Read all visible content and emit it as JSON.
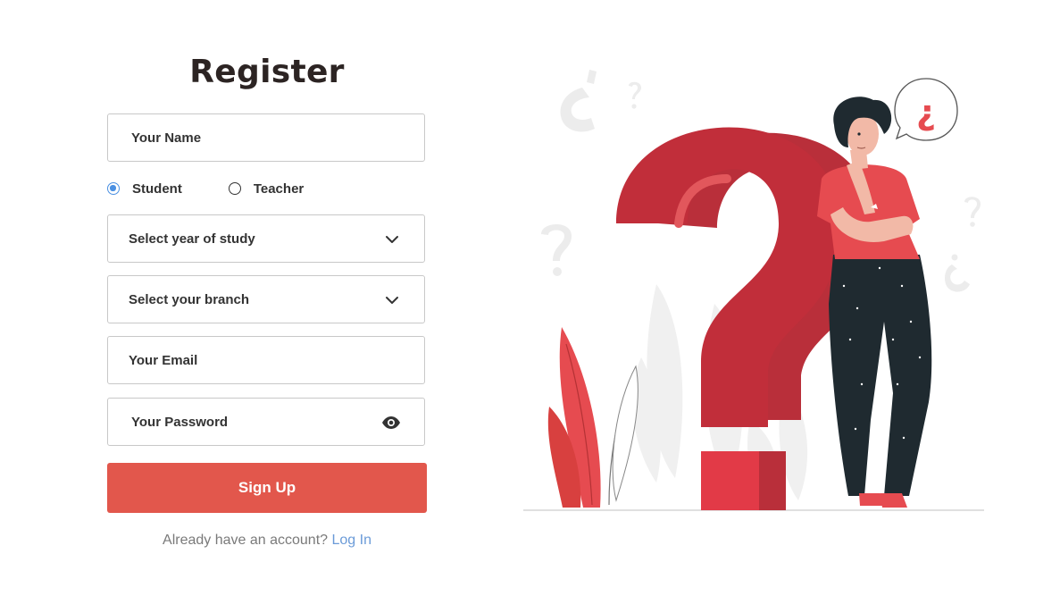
{
  "form": {
    "title": "Register",
    "name_placeholder": "Your Name",
    "role_options": [
      {
        "label": "Student",
        "checked": true
      },
      {
        "label": "Teacher",
        "checked": false
      }
    ],
    "year_select": "Select year of study",
    "branch_select": "Select your branch",
    "email_placeholder": "Your Email",
    "password_placeholder": "Your Password",
    "submit_label": "Sign Up",
    "login_prompt": "Already have an account?",
    "login_link": "Log In"
  },
  "icons": {
    "select_arrow": "chevron-down-icon",
    "password_toggle": "eye-icon"
  },
  "colors": {
    "accent": "#e2574c",
    "radio_selected": "#4a90e2",
    "link": "#6b9bd8"
  },
  "illustration": {
    "speech_bubble_text": "¿"
  }
}
